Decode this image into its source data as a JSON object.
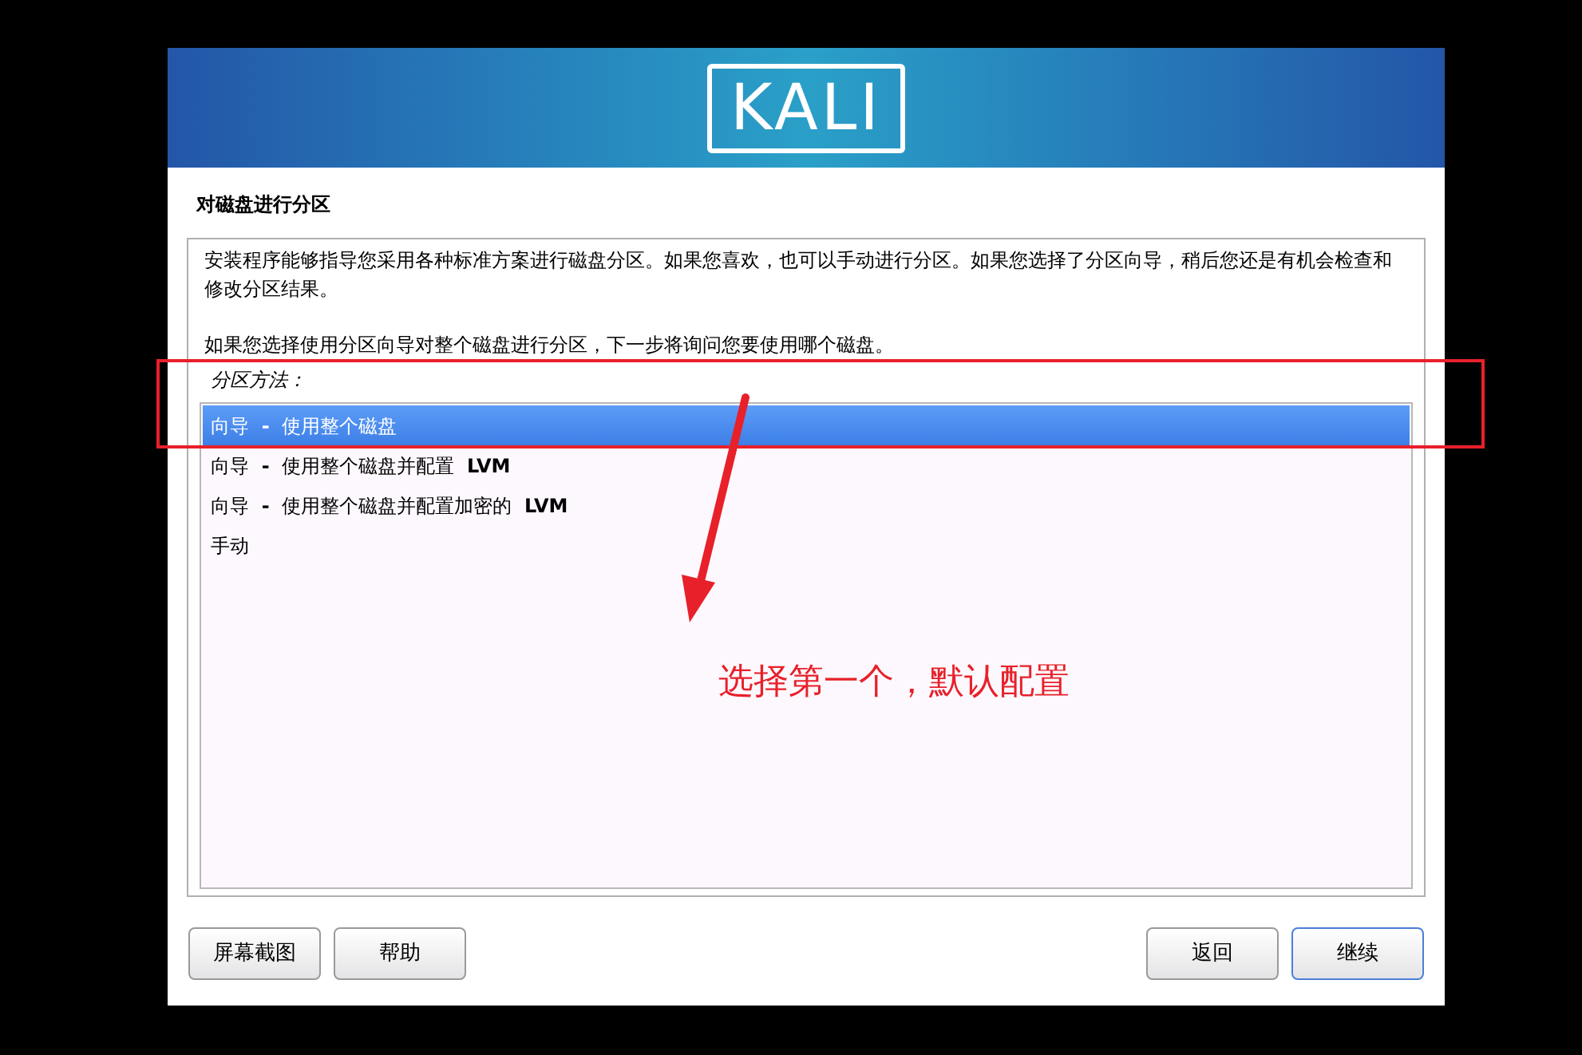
{
  "banner": {
    "logo": "KALI"
  },
  "title": "对磁盘进行分区",
  "description": [
    "安装程序能够指导您采用各种标准方案进行磁盘分区。如果您喜欢，也可以手动进行分区。如果您选择了分区向导，稍后您还是有机会检查和修改分区结果。",
    "如果您选择使用分区向导对整个磁盘进行分区，下一步将询问您要使用哪个磁盘。"
  ],
  "list_label": "分区方法：",
  "options": [
    {
      "label": "向导 **-** 使用整个磁盘",
      "selected": true
    },
    {
      "label": "向导 **-** 使用整个磁盘并配置 **LVM**",
      "selected": false
    },
    {
      "label": "向导 **-** 使用整个磁盘并配置加密的 **LVM**",
      "selected": false
    },
    {
      "label": "手动",
      "selected": false
    }
  ],
  "buttons_left": [
    {
      "label": "屏幕截图",
      "focused": false
    },
    {
      "label": "帮助",
      "focused": false
    }
  ],
  "buttons_right": [
    {
      "label": "返回",
      "focused": false
    },
    {
      "label": "继续",
      "focused": true
    }
  ],
  "annotation": {
    "text": "选择第一个，默认配置"
  }
}
